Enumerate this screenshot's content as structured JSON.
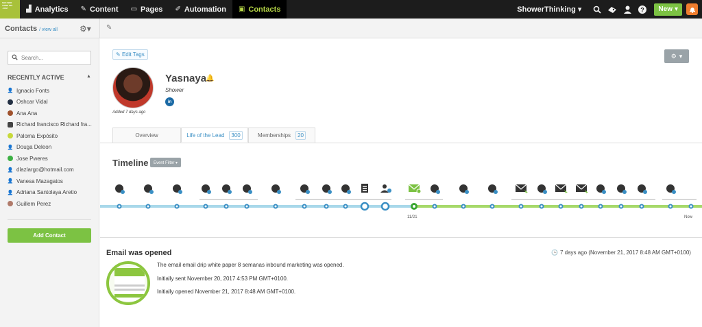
{
  "topnav": {
    "logo_text": "SHO WER THINK ING .COM",
    "items": [
      {
        "label": "Analytics",
        "icon": "analytics-icon",
        "glyph": "▟"
      },
      {
        "label": "Content",
        "icon": "content-icon",
        "glyph": "✎"
      },
      {
        "label": "Pages",
        "icon": "pages-icon",
        "glyph": "▭"
      },
      {
        "label": "Automation",
        "icon": "automation-icon",
        "glyph": "✐"
      },
      {
        "label": "Contacts",
        "icon": "contacts-icon",
        "glyph": "▣"
      }
    ],
    "account": "ShowerThinking ▾",
    "new_label": "New",
    "accent": "#b6d646",
    "new_color": "#7cc243"
  },
  "subbar": {
    "contacts_label": "Contacts",
    "view_all": "/ view all"
  },
  "sidebar": {
    "search_placeholder": "Search...",
    "recent_title": "RECENTLY ACTIVE",
    "contacts": [
      "Ignacio Fonts",
      "Oshcar Vidal",
      "Ana Ana",
      "Richard francisco Richard fra...",
      "Paloma Expósito",
      "Douga Deleon",
      "Jose Pweres",
      "dlazlargo@hotmail.com",
      "Vanesa Mazagatos",
      "Adriana Santolaya Aretio",
      "Guillem Perez"
    ],
    "add_contact": "Add Contact"
  },
  "profile": {
    "edit_tags": "Edit Tags",
    "name": "Yasnaya",
    "company": "Shower",
    "added": "Added 7 days ago",
    "linkedin": "in"
  },
  "tabs": [
    {
      "label": "Overview",
      "count": ""
    },
    {
      "label": "Life of the Lead",
      "count": "300"
    },
    {
      "label": "Memberships",
      "count": "20"
    }
  ],
  "timeline": {
    "title": "Timeline",
    "event_filter": "Event Filter ▾",
    "date_label": "11/21",
    "now_label": "Now"
  },
  "event": {
    "title": "Email was opened",
    "time": "7 days ago (November 21, 2017 8:48 AM GMT+0100)",
    "lines": [
      "The email email drip white paper 8 semanas inbound marketing was opened.",
      "Initially sent November 20, 2017 4:53 PM GMT+0100.",
      "Initially opened November 21, 2017 8:48 AM GMT+0100."
    ]
  }
}
